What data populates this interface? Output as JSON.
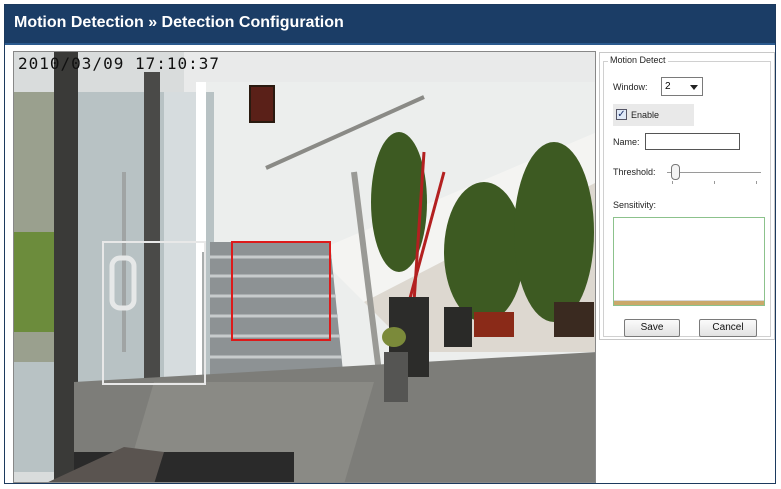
{
  "title": "Motion Detection » Detection Configuration",
  "video": {
    "timestamp": "2010/03/09 17:10:37"
  },
  "panel": {
    "legend": "Motion Detect",
    "window_label": "Window:",
    "window_value": "2",
    "enable_label": "Enable",
    "enable_checked": true,
    "name_label": "Name:",
    "name_value": "",
    "threshold_label": "Threshold:",
    "threshold_level": 0.05,
    "sensitivity_label": "Sensitivity:",
    "save_label": "Save",
    "cancel_label": "Cancel"
  },
  "colors": {
    "titlebar": "#1b3d66",
    "active_zone": "#dd1a1a",
    "inactive_zone": "#e8e8e8",
    "sensitivity_border": "#8cc28c"
  }
}
